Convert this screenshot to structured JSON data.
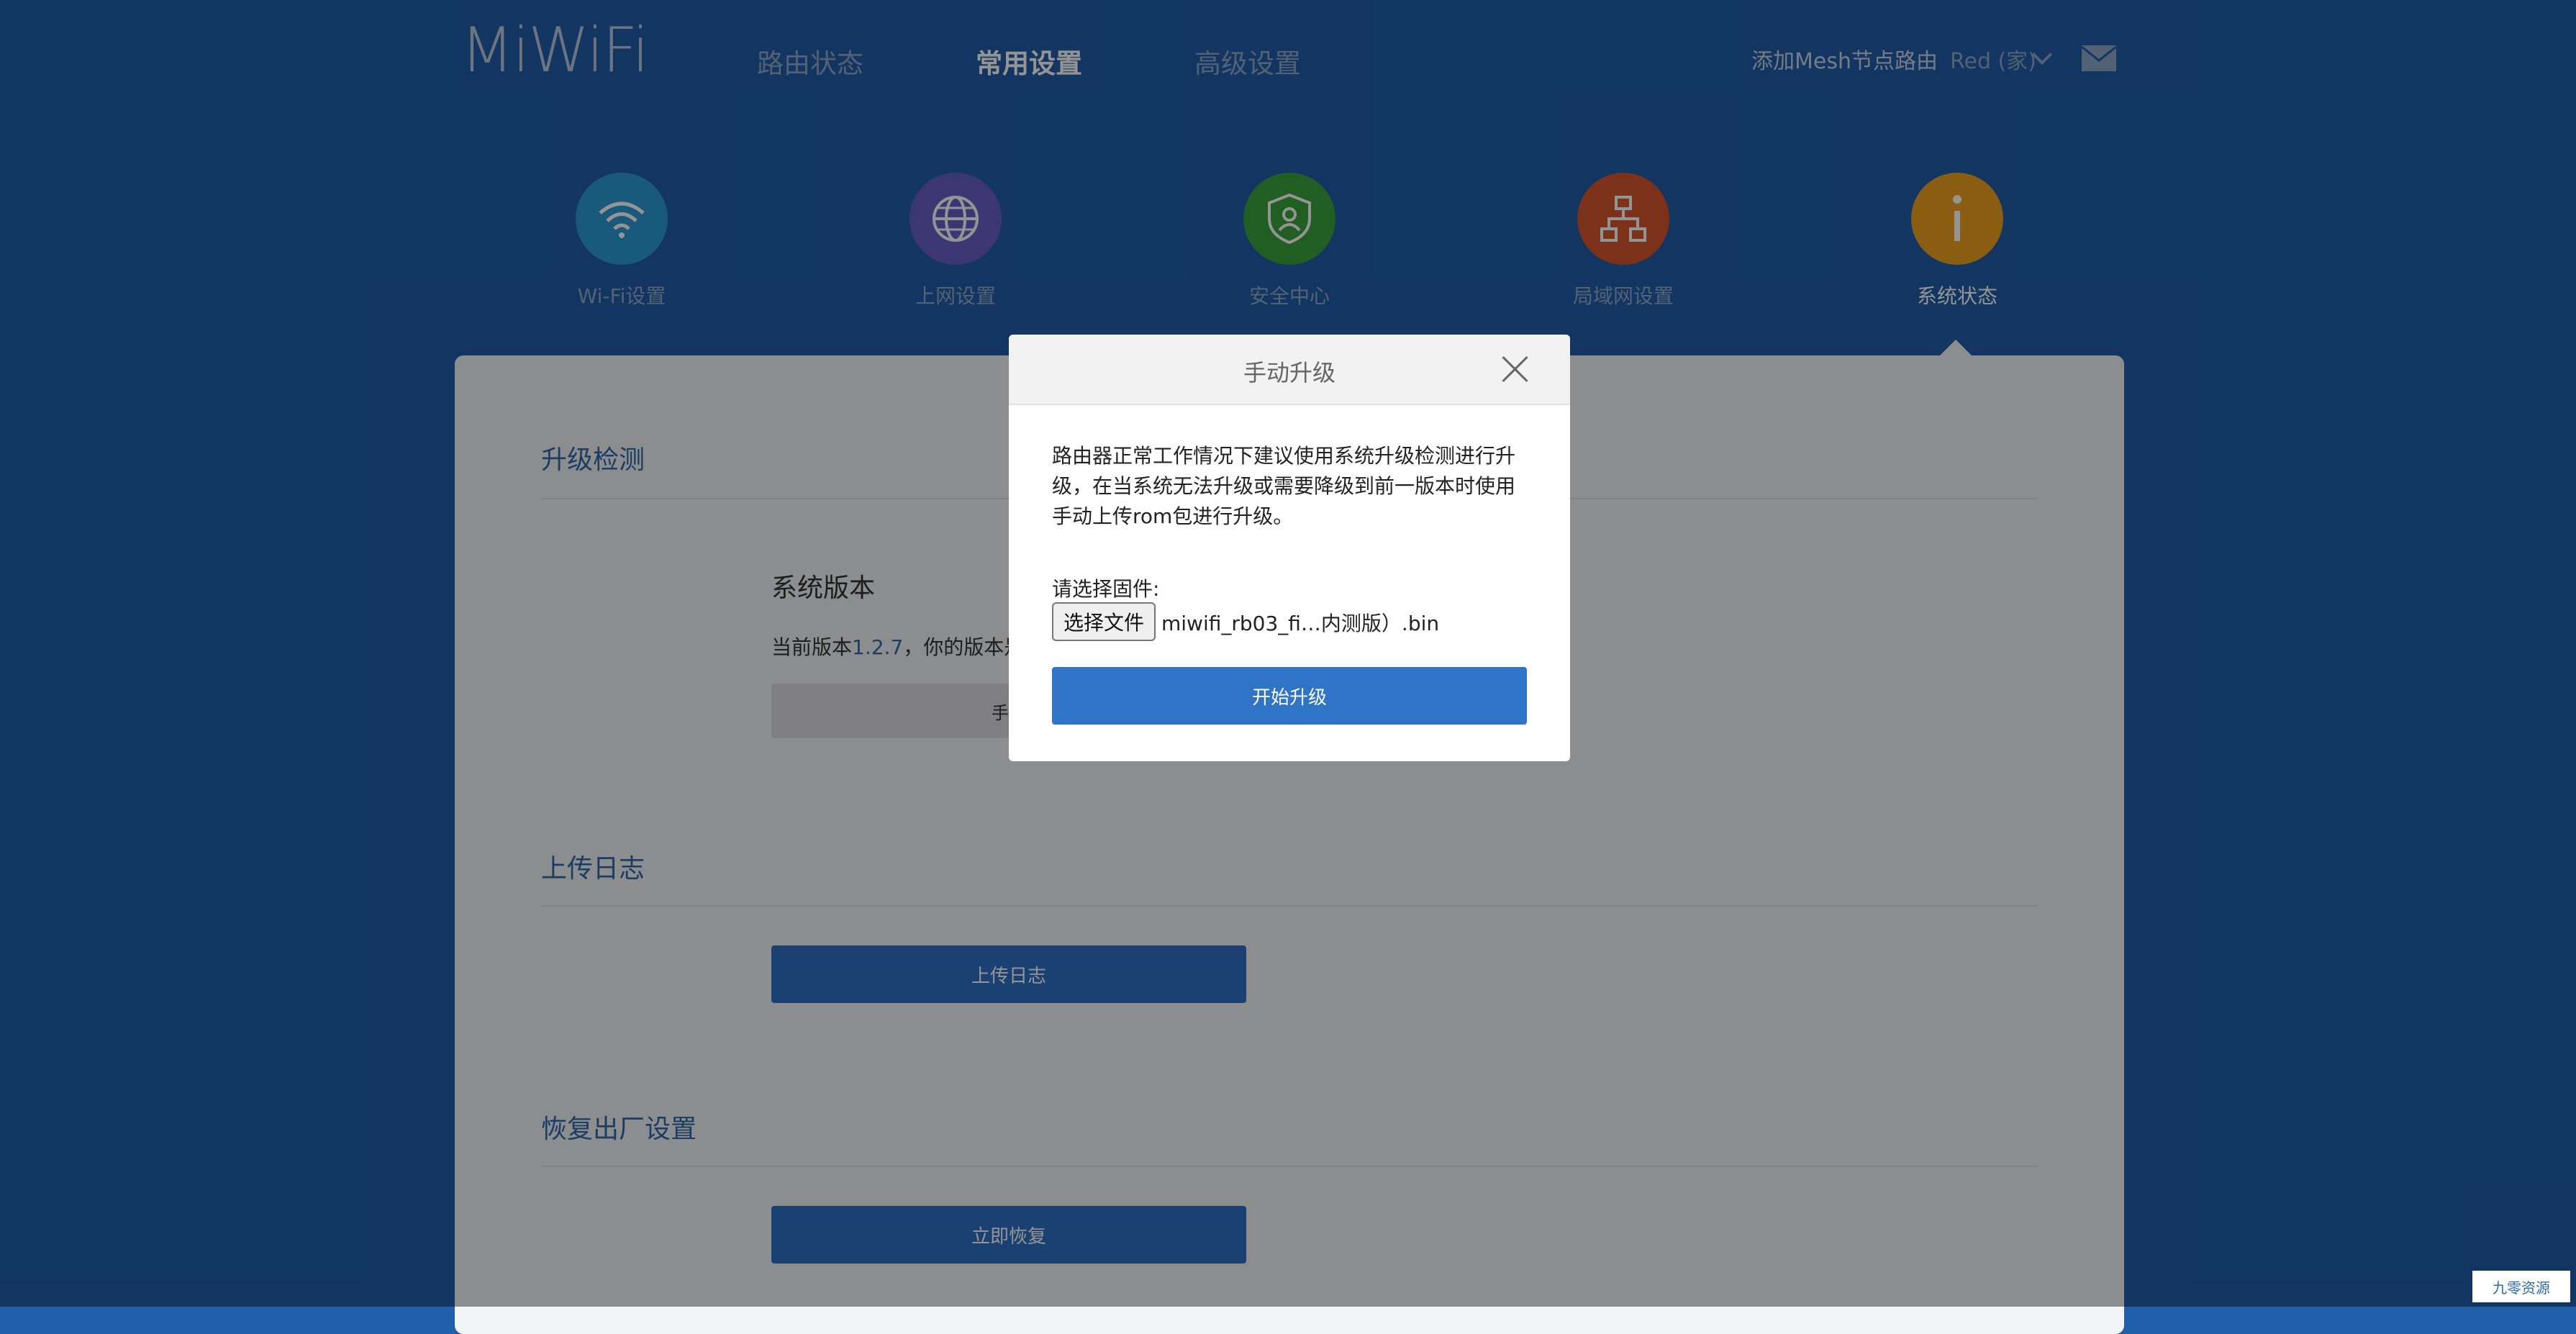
{
  "header": {
    "logo": "MiWiFi",
    "nav": [
      "路由状态",
      "常用设置",
      "高级设置"
    ],
    "add_mesh": "添加Mesh节点路由",
    "user": "Red (家)"
  },
  "features": [
    {
      "label": "Wi-Fi设置",
      "icon": "wifi-icon",
      "color": "#2a99d6"
    },
    {
      "label": "上网设置",
      "icon": "globe-icon",
      "color": "#6a5ec9"
    },
    {
      "label": "安全中心",
      "icon": "shield-icon",
      "color": "#3aa33a"
    },
    {
      "label": "局域网设置",
      "icon": "network-icon",
      "color": "#d5572b"
    },
    {
      "label": "系统状态",
      "icon": "info-icon",
      "color": "#f0a020"
    }
  ],
  "sections": {
    "upgrade": {
      "title": "升级检测",
      "sub_title": "系统版本",
      "current_prefix": "当前版本",
      "version": "1.2.7",
      "current_suffix": "，你的版本是",
      "manual_button": "手动"
    },
    "log": {
      "title": "上传日志",
      "button": "上传日志"
    },
    "reset": {
      "title": "恢复出厂设置",
      "button": "立即恢复"
    }
  },
  "modal": {
    "title": "手动升级",
    "description": "路由器正常工作情况下建议使用系统升级检测进行升级，在当系统无法升级或需要降级到前一版本时使用手动上传rom包进行升级。",
    "firmware_label": "请选择固件:",
    "choose_file_button": "选择文件",
    "file_name": "miwifi_rb03_fi…内测版）.bin",
    "start_button": "开始升级"
  },
  "watermark": "九零资源"
}
